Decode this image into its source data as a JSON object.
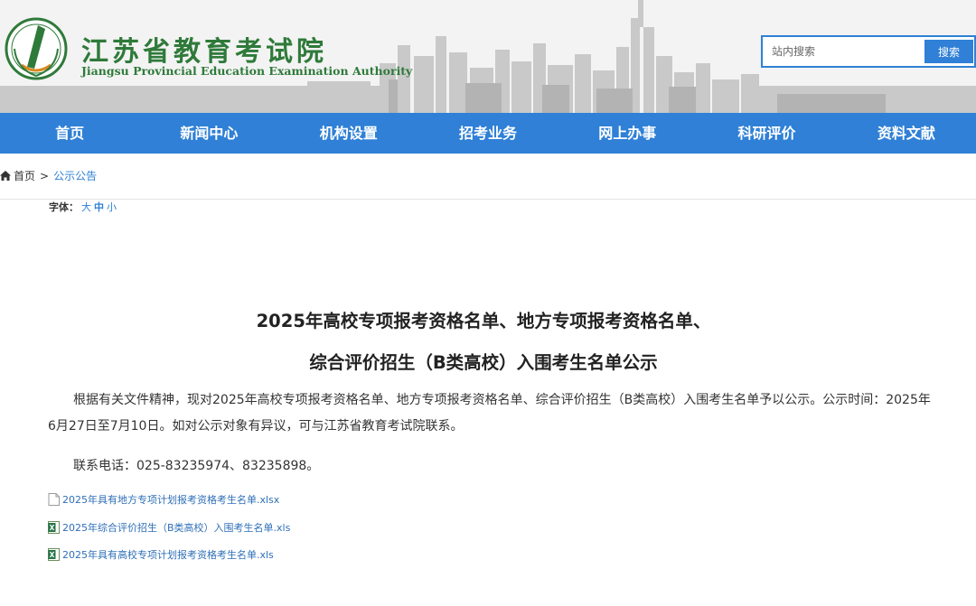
{
  "header": {
    "logo_cn": "江苏省教育考试院",
    "logo_en": "Jiangsu Provincial Education Examination Authority",
    "search_placeholder": "站内搜索",
    "search_button": "搜索"
  },
  "nav": {
    "items": [
      {
        "label": "首页"
      },
      {
        "label": "新闻中心"
      },
      {
        "label": "机构设置"
      },
      {
        "label": "招考业务"
      },
      {
        "label": "网上办事"
      },
      {
        "label": "科研评价"
      },
      {
        "label": "资料文献"
      }
    ]
  },
  "breadcrumb": {
    "home": "首页",
    "separator": ">",
    "current": "公示公告"
  },
  "font_size": {
    "label": "字体：",
    "large": "大",
    "medium": "中",
    "small": "小"
  },
  "article": {
    "title_line1": "2025年高校专项报考资格名单、地方专项报考资格名单、",
    "title_line2": "综合评价招生（B类高校）入围考生名单公示",
    "paragraph1": "根据有关文件精神，现对2025年高校专项报考资格名单、地方专项报考资格名单、综合评价招生（B类高校）入围考生名单予以公示。公示时间：2025年6月27日至7月10日。如对公示对象有异议，可与江苏省教育考试院联系。",
    "paragraph2": "联系电话：025-83235974、83235898。"
  },
  "attachments": [
    {
      "name": "2025年具有地方专项计划报考资格考生名单.xlsx",
      "icon": "file-icon"
    },
    {
      "name": "2025年综合评价招生（B类高校）入围考生名单.xls",
      "icon": "excel-icon"
    },
    {
      "name": "2025年具有高校专项计划报考资格考生名单.xls",
      "icon": "excel-icon"
    }
  ],
  "colors": {
    "brand_blue": "#2f80d6",
    "logo_green": "#2f7a3a",
    "link_blue": "#2f6fb7"
  }
}
